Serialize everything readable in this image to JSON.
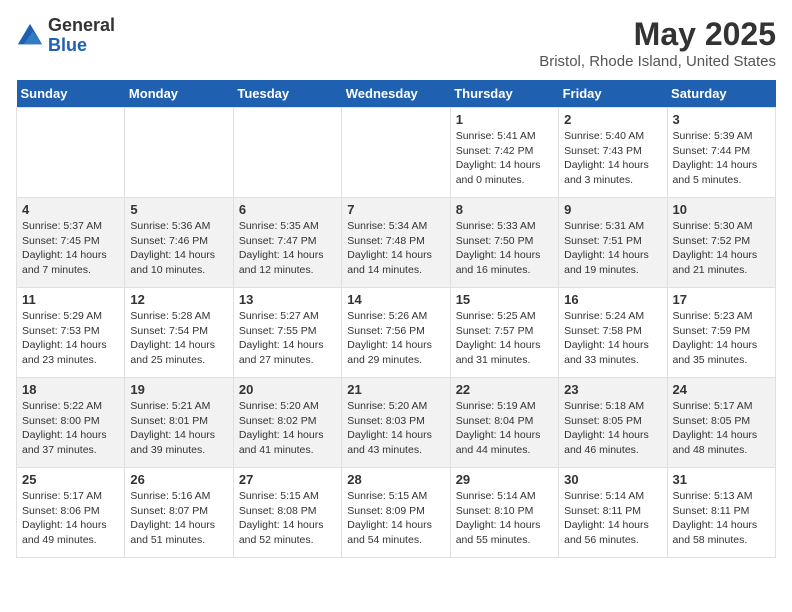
{
  "header": {
    "logo_line1": "General",
    "logo_line2": "Blue",
    "title": "May 2025",
    "subtitle": "Bristol, Rhode Island, United States"
  },
  "days_of_week": [
    "Sunday",
    "Monday",
    "Tuesday",
    "Wednesday",
    "Thursday",
    "Friday",
    "Saturday"
  ],
  "weeks": [
    [
      {
        "day": "",
        "content": ""
      },
      {
        "day": "",
        "content": ""
      },
      {
        "day": "",
        "content": ""
      },
      {
        "day": "",
        "content": ""
      },
      {
        "day": "1",
        "content": "Sunrise: 5:41 AM\nSunset: 7:42 PM\nDaylight: 14 hours\nand 0 minutes."
      },
      {
        "day": "2",
        "content": "Sunrise: 5:40 AM\nSunset: 7:43 PM\nDaylight: 14 hours\nand 3 minutes."
      },
      {
        "day": "3",
        "content": "Sunrise: 5:39 AM\nSunset: 7:44 PM\nDaylight: 14 hours\nand 5 minutes."
      }
    ],
    [
      {
        "day": "4",
        "content": "Sunrise: 5:37 AM\nSunset: 7:45 PM\nDaylight: 14 hours\nand 7 minutes."
      },
      {
        "day": "5",
        "content": "Sunrise: 5:36 AM\nSunset: 7:46 PM\nDaylight: 14 hours\nand 10 minutes."
      },
      {
        "day": "6",
        "content": "Sunrise: 5:35 AM\nSunset: 7:47 PM\nDaylight: 14 hours\nand 12 minutes."
      },
      {
        "day": "7",
        "content": "Sunrise: 5:34 AM\nSunset: 7:48 PM\nDaylight: 14 hours\nand 14 minutes."
      },
      {
        "day": "8",
        "content": "Sunrise: 5:33 AM\nSunset: 7:50 PM\nDaylight: 14 hours\nand 16 minutes."
      },
      {
        "day": "9",
        "content": "Sunrise: 5:31 AM\nSunset: 7:51 PM\nDaylight: 14 hours\nand 19 minutes."
      },
      {
        "day": "10",
        "content": "Sunrise: 5:30 AM\nSunset: 7:52 PM\nDaylight: 14 hours\nand 21 minutes."
      }
    ],
    [
      {
        "day": "11",
        "content": "Sunrise: 5:29 AM\nSunset: 7:53 PM\nDaylight: 14 hours\nand 23 minutes."
      },
      {
        "day": "12",
        "content": "Sunrise: 5:28 AM\nSunset: 7:54 PM\nDaylight: 14 hours\nand 25 minutes."
      },
      {
        "day": "13",
        "content": "Sunrise: 5:27 AM\nSunset: 7:55 PM\nDaylight: 14 hours\nand 27 minutes."
      },
      {
        "day": "14",
        "content": "Sunrise: 5:26 AM\nSunset: 7:56 PM\nDaylight: 14 hours\nand 29 minutes."
      },
      {
        "day": "15",
        "content": "Sunrise: 5:25 AM\nSunset: 7:57 PM\nDaylight: 14 hours\nand 31 minutes."
      },
      {
        "day": "16",
        "content": "Sunrise: 5:24 AM\nSunset: 7:58 PM\nDaylight: 14 hours\nand 33 minutes."
      },
      {
        "day": "17",
        "content": "Sunrise: 5:23 AM\nSunset: 7:59 PM\nDaylight: 14 hours\nand 35 minutes."
      }
    ],
    [
      {
        "day": "18",
        "content": "Sunrise: 5:22 AM\nSunset: 8:00 PM\nDaylight: 14 hours\nand 37 minutes."
      },
      {
        "day": "19",
        "content": "Sunrise: 5:21 AM\nSunset: 8:01 PM\nDaylight: 14 hours\nand 39 minutes."
      },
      {
        "day": "20",
        "content": "Sunrise: 5:20 AM\nSunset: 8:02 PM\nDaylight: 14 hours\nand 41 minutes."
      },
      {
        "day": "21",
        "content": "Sunrise: 5:20 AM\nSunset: 8:03 PM\nDaylight: 14 hours\nand 43 minutes."
      },
      {
        "day": "22",
        "content": "Sunrise: 5:19 AM\nSunset: 8:04 PM\nDaylight: 14 hours\nand 44 minutes."
      },
      {
        "day": "23",
        "content": "Sunrise: 5:18 AM\nSunset: 8:05 PM\nDaylight: 14 hours\nand 46 minutes."
      },
      {
        "day": "24",
        "content": "Sunrise: 5:17 AM\nSunset: 8:05 PM\nDaylight: 14 hours\nand 48 minutes."
      }
    ],
    [
      {
        "day": "25",
        "content": "Sunrise: 5:17 AM\nSunset: 8:06 PM\nDaylight: 14 hours\nand 49 minutes."
      },
      {
        "day": "26",
        "content": "Sunrise: 5:16 AM\nSunset: 8:07 PM\nDaylight: 14 hours\nand 51 minutes."
      },
      {
        "day": "27",
        "content": "Sunrise: 5:15 AM\nSunset: 8:08 PM\nDaylight: 14 hours\nand 52 minutes."
      },
      {
        "day": "28",
        "content": "Sunrise: 5:15 AM\nSunset: 8:09 PM\nDaylight: 14 hours\nand 54 minutes."
      },
      {
        "day": "29",
        "content": "Sunrise: 5:14 AM\nSunset: 8:10 PM\nDaylight: 14 hours\nand 55 minutes."
      },
      {
        "day": "30",
        "content": "Sunrise: 5:14 AM\nSunset: 8:11 PM\nDaylight: 14 hours\nand 56 minutes."
      },
      {
        "day": "31",
        "content": "Sunrise: 5:13 AM\nSunset: 8:11 PM\nDaylight: 14 hours\nand 58 minutes."
      }
    ]
  ]
}
